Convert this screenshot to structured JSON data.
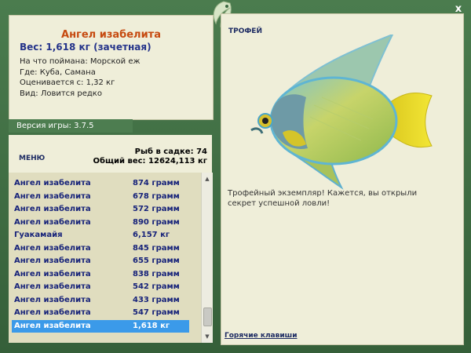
{
  "fish": {
    "name": "Ангел изабелита",
    "weight_line": "Вес: 1,618 кг (зачетная)",
    "bait": "На что поймана: Морской еж",
    "location": "Где: Куба, Самана",
    "valued_from": "Оценивается с: 1,32 кг",
    "species_note": "Вид: Ловится редко"
  },
  "version": "Версия игры: 3.7.5",
  "menu_label": "МЕНЮ",
  "stats": {
    "fish_in_net": "Рыб в садке: 74",
    "total_weight": "Общий вес: 12624,113 кг"
  },
  "catch_list": [
    {
      "name": "Ангел изабелита",
      "weight": "874 грамм"
    },
    {
      "name": "Ангел изабелита",
      "weight": "678 грамм"
    },
    {
      "name": "Ангел изабелита",
      "weight": "572 грамм"
    },
    {
      "name": "Ангел изабелита",
      "weight": "890 грамм"
    },
    {
      "name": "Гуакамайя",
      "weight": "6,157 кг"
    },
    {
      "name": "Ангел изабелита",
      "weight": "845 грамм"
    },
    {
      "name": "Ангел изабелита",
      "weight": "655 грамм"
    },
    {
      "name": "Ангел изабелита",
      "weight": "838 грамм"
    },
    {
      "name": "Ангел изабелита",
      "weight": "542 грамм"
    },
    {
      "name": "Ангел изабелита",
      "weight": "433 грамм"
    },
    {
      "name": "Ангел изабелита",
      "weight": "547 грамм"
    },
    {
      "name": "Ангел изабелита",
      "weight": "1,618 кг"
    }
  ],
  "selected_index": 11,
  "trophy": {
    "label": "ТРОФЕЙ",
    "text": "Трофейный экземпляр! Кажется, вы открыли секрет успешной ловли!"
  },
  "hotkeys_label": "Горячие клавиши",
  "close_label": "x",
  "colors": {
    "frame_green": "#3c6a41",
    "panel_bg": "#efeed9",
    "list_bg": "#e0ddbf",
    "title_orange": "#c64a10",
    "text_navy": "#17237a",
    "selection_blue": "#3b9ae9"
  }
}
